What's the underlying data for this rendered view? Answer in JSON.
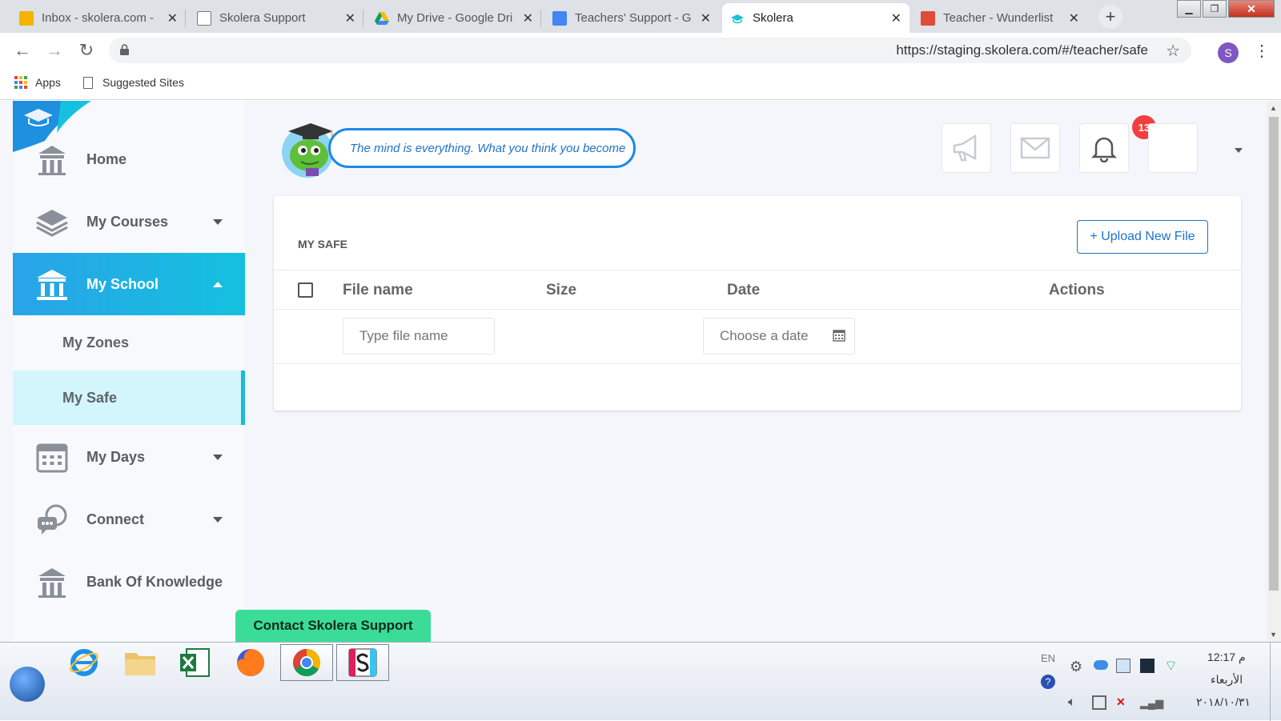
{
  "browser": {
    "tabs": [
      {
        "title": "Inbox - skolera.com -",
        "favicon_color": "#f4b400"
      },
      {
        "title": "Skolera Support",
        "favicon_color": "#888888"
      },
      {
        "title": "My Drive - Google Dri",
        "favicon_color": "#0f9d58"
      },
      {
        "title": "Teachers' Support - G",
        "favicon_color": "#4285f4"
      },
      {
        "title": "Skolera",
        "favicon_color": "#16c3d6"
      },
      {
        "title": "Teacher - Wunderlist",
        "favicon_color": "#e04a3a"
      }
    ],
    "active_tab_index": 4,
    "new_tab_icon": "+",
    "url": "https://staging.skolera.com/#/teacher/safe",
    "profile_initial": "S",
    "bookmarks": [
      {
        "label": "Apps"
      },
      {
        "label": "Suggested Sites"
      }
    ]
  },
  "sidebar": {
    "items": [
      {
        "label": "Home",
        "icon": "school-building-icon",
        "has_caret": false
      },
      {
        "label": "My Courses",
        "icon": "stack-books-icon",
        "has_caret": true
      },
      {
        "label": "My School",
        "icon": "institution-icon",
        "has_caret": true,
        "active": true
      },
      {
        "label": "My Days",
        "icon": "calendar-icon",
        "has_caret": true
      },
      {
        "label": "Connect",
        "icon": "chat-bubbles-icon",
        "has_caret": true
      },
      {
        "label": "Bank Of Knowledge",
        "icon": "school-building-icon",
        "has_caret": false
      }
    ],
    "subitems": [
      {
        "label": "My Zones"
      },
      {
        "label": "My Safe",
        "selected": true
      }
    ],
    "contact_support": "Contact Skolera Support"
  },
  "header": {
    "quote": "The mind is everything. What you think you become",
    "notifications_count": "13"
  },
  "safe": {
    "title": "MY SAFE",
    "upload_label": "+ Upload New File",
    "columns": {
      "file_name": "File name",
      "size": "Size",
      "date": "Date",
      "actions": "Actions"
    },
    "filter_filename_placeholder": "Type file name",
    "filter_date_placeholder": "Choose a date"
  },
  "taskbar": {
    "language": "EN",
    "time": "12:17 م",
    "day": "الأربعاء",
    "date": "٢٠١٨/١٠/٣١"
  },
  "colors": {
    "accent_gradient_start": "#29a3e8",
    "accent_gradient_end": "#14c1de",
    "link_blue": "#1f73c8",
    "badge_red": "#f23e3e",
    "support_green": "#3bdc97"
  }
}
